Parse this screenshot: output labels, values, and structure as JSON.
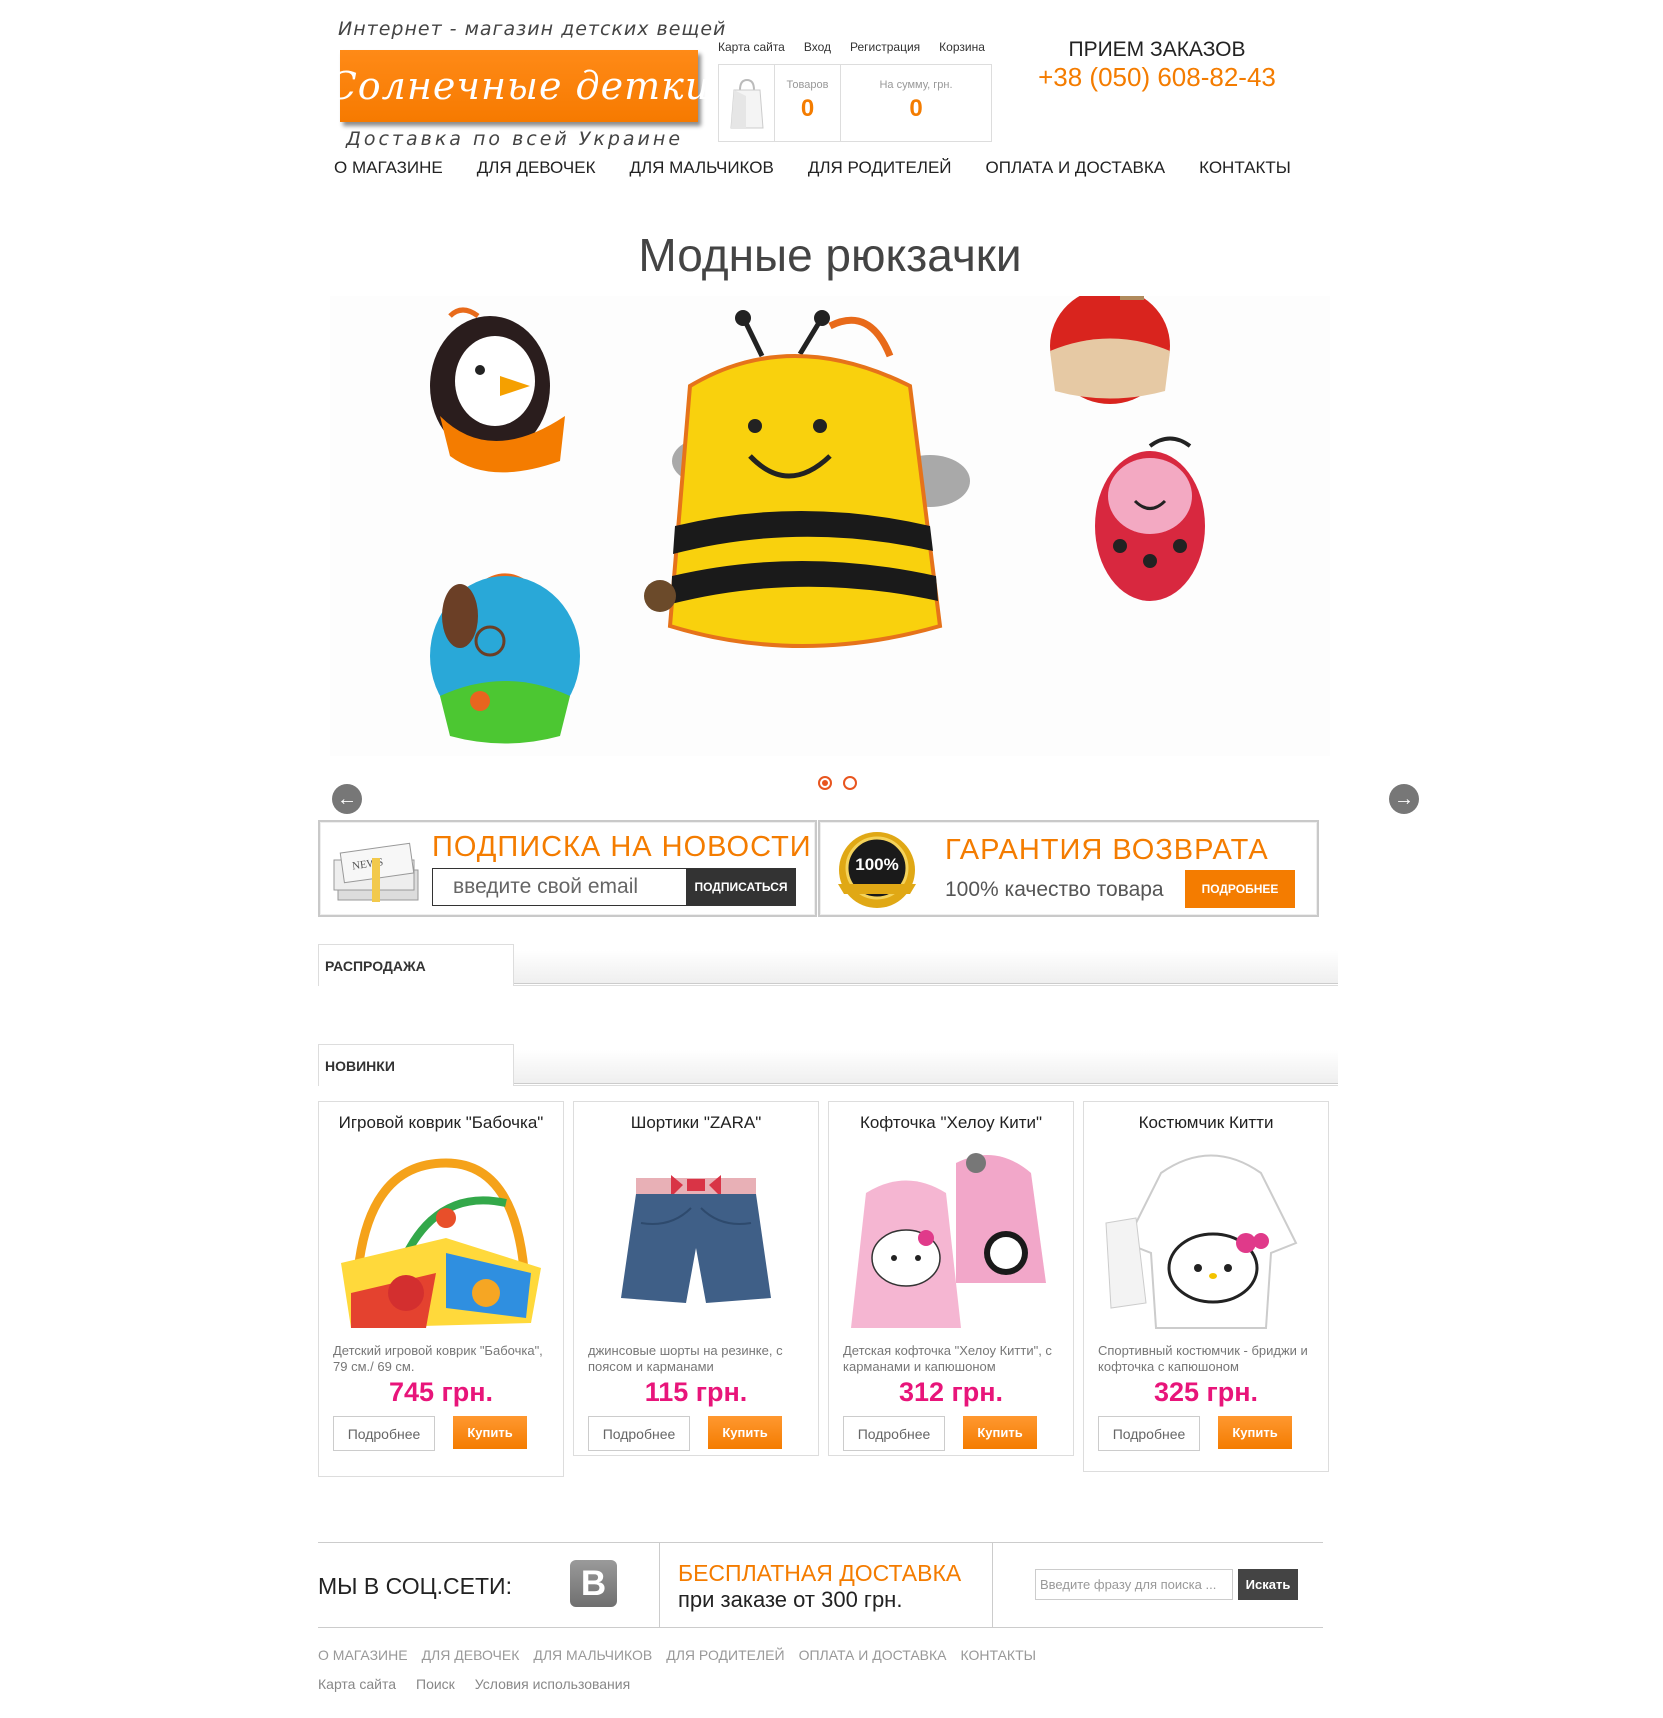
{
  "header": {
    "logo_top": "Интернет - магазин детских вещей",
    "logo_name": "Солнечные детки",
    "logo_bottom": "Доставка по всей Украине",
    "top_links": [
      "Карта сайта",
      "Вход",
      "Регистрация",
      "Корзина"
    ],
    "cart": {
      "items_label": "Товаров",
      "items_count": "0",
      "sum_label": "На сумму, грн.",
      "sum_value": "0"
    },
    "orders_title": "ПРИЕМ ЗАКАЗОВ",
    "phone": "+38 (050) 608-82-43"
  },
  "nav": [
    "О МАГАЗИНЕ",
    "ДЛЯ ДЕВОЧЕК",
    "ДЛЯ МАЛЬЧИКОВ",
    "ДЛЯ РОДИТЕЛЕЙ",
    "ОПЛАТА И ДОСТАВКА",
    "КОНТАКТЫ"
  ],
  "slider": {
    "title": "Модные рюкзачки",
    "slides": 2,
    "active_slide": 1
  },
  "subscribe": {
    "title": "ПОДПИСКА НА НОВОСТИ",
    "placeholder": "введите свой email",
    "button": "ПОДПИСАТЬСЯ"
  },
  "guarantee": {
    "badge": "100%",
    "title": "ГАРАНТИЯ ВОЗВРАТА",
    "subtitle": "100% качество товара",
    "button": "ПОДРОБНЕЕ"
  },
  "sections": {
    "sale": "РАСПРОДАЖА",
    "new": "НОВИНКИ"
  },
  "products": [
    {
      "name": "Игровой коврик \"Бабочка\"",
      "description": "Детский игровой коврик \"Бабочка\", 79 см./ 69 см.",
      "price": "745 грн.",
      "more": "Подробнее",
      "buy": "Купить"
    },
    {
      "name": "Шортики \"ZARA\"",
      "description": "джинсовые шорты на резинке, с поясом и карманами",
      "price": "115 грн.",
      "more": "Подробнее",
      "buy": "Купить"
    },
    {
      "name": "Кофточка \"Хелоу Кити\"",
      "description": "Детская кофточка \"Хелоу Китти\", с карманами и капюшоном",
      "price": "312 грн.",
      "more": "Подробнее",
      "buy": "Купить"
    },
    {
      "name": "Костюмчик Китти",
      "description": "Спортивный костюмчик - бриджи и кофточка с капюшоном",
      "price": "325 грн.",
      "more": "Подробнее",
      "buy": "Купить"
    }
  ],
  "footer": {
    "social_label": "МЫ В СОЦ.СЕТИ:",
    "vk_icon": "В",
    "free_delivery": "БЕСПЛАТНАЯ ДОСТАВКА",
    "free_delivery_sub": "при заказе от 300 грн.",
    "search_placeholder": "Введите фразу для поиска ...",
    "search_button": "Искать",
    "nav": [
      "О МАГАЗИНЕ",
      "ДЛЯ ДЕВОЧЕК",
      "ДЛЯ МАЛЬЧИКОВ",
      "ДЛЯ РОДИТЕЛЕЙ",
      "ОПЛАТА И ДОСТАВКА",
      "КОНТАКТЫ"
    ],
    "links": [
      "Карта сайта",
      "Поиск",
      "Условия использования"
    ]
  },
  "colors": {
    "accent": "#f47c00",
    "price": "#e8157a",
    "dark_button": "#333333"
  }
}
